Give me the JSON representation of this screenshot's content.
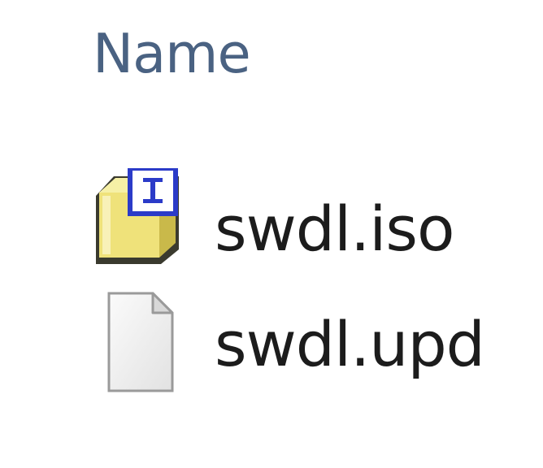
{
  "column_header": {
    "name_label": "Name"
  },
  "files": [
    {
      "name": "swdl.iso",
      "icon": "disc-image-icon"
    },
    {
      "name": "swdl.upd",
      "icon": "blank-file-icon"
    }
  ]
}
